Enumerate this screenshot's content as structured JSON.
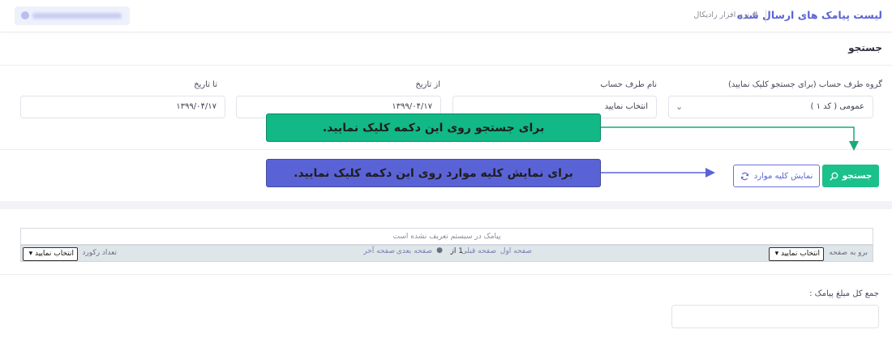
{
  "header": {
    "title": "لیست پیامک های ارسال شده",
    "breadcrumb": "# نرم افزار رادیکال",
    "date_pill_icon": "calendar-dot-icon"
  },
  "search": {
    "section_title": "جستجو",
    "fields": {
      "group_label": "گروه طرف حساب (برای جستجو کلیک نمایید)",
      "group_value": "عمومی ( کد ۱ )",
      "account_label": "نام طرف حساب",
      "account_placeholder": "انتخاب نمایید",
      "from_date_label": "از تاریخ",
      "from_date_value": "۱۳۹۹/۰۴/۱۷",
      "to_date_label": "تا تاریخ",
      "to_date_value": "۱۳۹۹/۰۴/۱۷"
    },
    "search_button": "جستجو",
    "show_all_button": "نمایش کلیه موارد"
  },
  "callouts": {
    "search_hint": "برای جستجو روی این دکمه کلیک نمایید.",
    "show_all_hint": "برای نمایش کلیه موارد روی این دکمه کلیک نمایید."
  },
  "grid": {
    "empty_message": "پیامک در سیستم تعریف نشده است",
    "goto_page_label": "برو به صفحه",
    "goto_page_select": "انتخاب نمایید",
    "first_page": "صفحه اول",
    "prev_page": "صفحه قبلی",
    "page_info": "1 از",
    "next_page": "صفحه بعدی",
    "last_page": "صفحه آخر",
    "record_count_label": "تعداد رکورد",
    "record_count_select": "انتخاب نمایید"
  },
  "summary": {
    "total_label": "جمع کل مبلغ پیامک :",
    "total_value": ""
  },
  "colors": {
    "accent": "#5a63d6",
    "success": "#1bc08a",
    "callout_green": "#12b886",
    "callout_blue": "#5a63d6"
  }
}
